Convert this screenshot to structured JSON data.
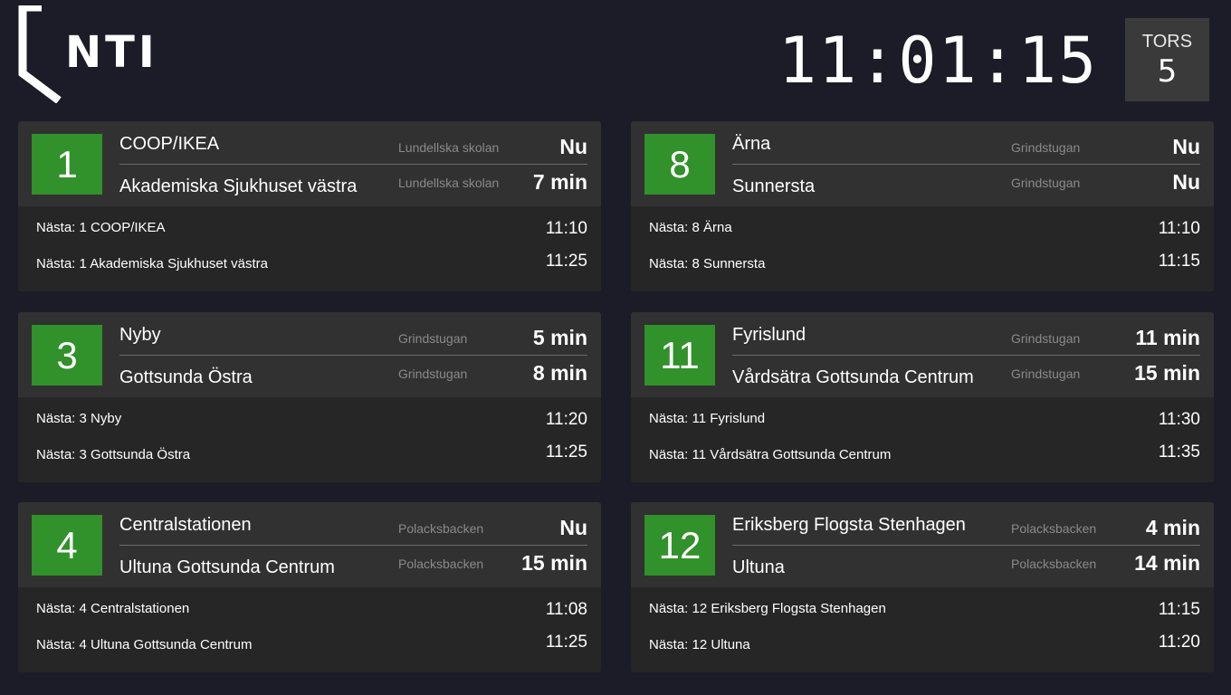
{
  "logo": {
    "text": "NTI"
  },
  "clock": {
    "time": "11:01:15"
  },
  "date": {
    "day_name": "TORS",
    "day_number": "5"
  },
  "lines": [
    {
      "number": "1",
      "departures": [
        {
          "destination": "COOP/IKEA",
          "stop": "Lundellska skolan",
          "time": "Nu"
        },
        {
          "destination": "Akademiska Sjukhuset västra",
          "stop": "Lundellska skolan",
          "time": "7 min"
        }
      ],
      "next": [
        {
          "label": "Nästa: 1 COOP/IKEA",
          "time": "11:10"
        },
        {
          "label": "Nästa: 1 Akademiska Sjukhuset västra",
          "time": "11:25"
        }
      ]
    },
    {
      "number": "8",
      "departures": [
        {
          "destination": "Ärna",
          "stop": "Grindstugan",
          "time": "Nu"
        },
        {
          "destination": "Sunnersta",
          "stop": "Grindstugan",
          "time": "Nu"
        }
      ],
      "next": [
        {
          "label": "Nästa: 8 Ärna",
          "time": "11:10"
        },
        {
          "label": "Nästa: 8 Sunnersta",
          "time": "11:15"
        }
      ]
    },
    {
      "number": "3",
      "departures": [
        {
          "destination": "Nyby",
          "stop": "Grindstugan",
          "time": "5 min"
        },
        {
          "destination": "Gottsunda Östra",
          "stop": "Grindstugan",
          "time": "8 min"
        }
      ],
      "next": [
        {
          "label": "Nästa: 3 Nyby",
          "time": "11:20"
        },
        {
          "label": "Nästa: 3 Gottsunda Östra",
          "time": "11:25"
        }
      ]
    },
    {
      "number": "11",
      "departures": [
        {
          "destination": "Fyrislund",
          "stop": "Grindstugan",
          "time": "11 min"
        },
        {
          "destination": "Vårdsätra Gottsunda Centrum",
          "stop": "Grindstugan",
          "time": "15 min"
        }
      ],
      "next": [
        {
          "label": "Nästa: 11 Fyrislund",
          "time": "11:30"
        },
        {
          "label": "Nästa: 11 Vårdsätra Gottsunda Centrum",
          "time": "11:35"
        }
      ]
    },
    {
      "number": "4",
      "departures": [
        {
          "destination": "Centralstationen",
          "stop": "Polacksbacken",
          "time": "Nu"
        },
        {
          "destination": "Ultuna Gottsunda Centrum",
          "stop": "Polacksbacken",
          "time": "15 min"
        }
      ],
      "next": [
        {
          "label": "Nästa: 4 Centralstationen",
          "time": "11:08"
        },
        {
          "label": "Nästa: 4 Ultuna Gottsunda Centrum",
          "time": "11:25"
        }
      ]
    },
    {
      "number": "12",
      "departures": [
        {
          "destination": "Eriksberg Flogsta Stenhagen",
          "stop": "Polacksbacken",
          "time": "4 min"
        },
        {
          "destination": "Ultuna",
          "stop": "Polacksbacken",
          "time": "14 min"
        }
      ],
      "next": [
        {
          "label": "Nästa: 12 Eriksberg Flogsta Stenhagen",
          "time": "11:15"
        },
        {
          "label": "Nästa: 12 Ultuna",
          "time": "11:20"
        }
      ]
    }
  ],
  "colors": {
    "background": "#1c1c28",
    "badge": "#31912a",
    "card": "#262626",
    "card_top": "#313131"
  }
}
